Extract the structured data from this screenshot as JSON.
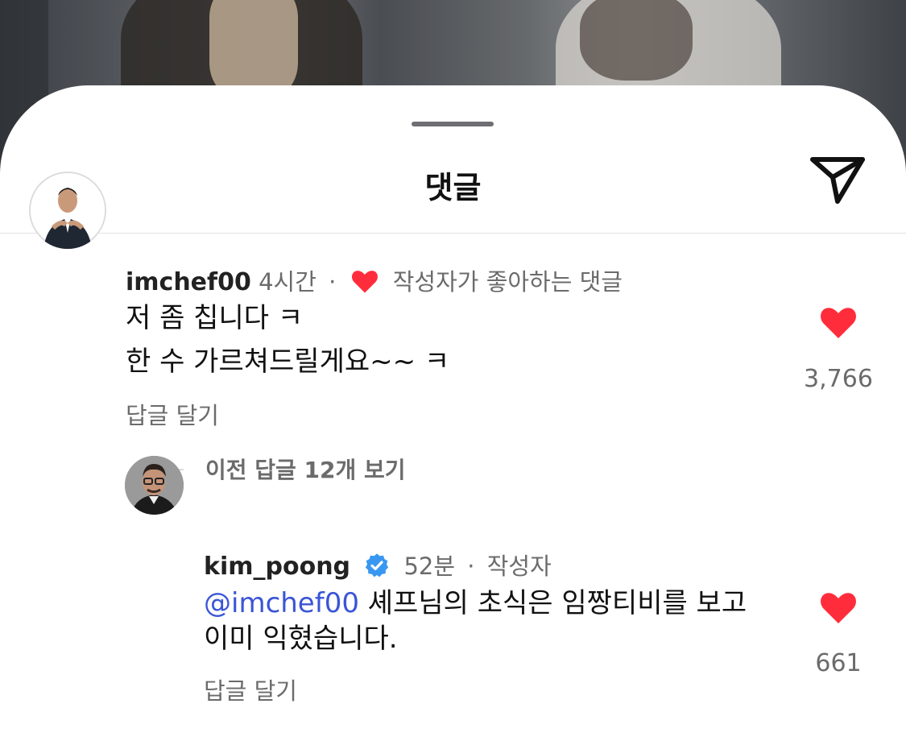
{
  "sheet": {
    "title": "댓글",
    "share_icon": "paper-plane-icon"
  },
  "comments": [
    {
      "username": "imchef00",
      "time": "4시간",
      "creator_liked_label": "작성자가 좋아하는 댓글",
      "lines": [
        "저 좀 칩니다 ㅋ",
        "한 수 가르쳐드릴게요~~ ㅋ"
      ],
      "like_count": "3,766",
      "liked": true,
      "reply_label": "답글 달기",
      "view_replies_label": "이전 답글 12개 보기"
    },
    {
      "username": "kim_poong",
      "verified": true,
      "time": "52분",
      "author_label": "작성자",
      "mention": "@imchef00",
      "lines": [
        " 셰프님의 초식은 임짱티비를 보고",
        "이미 익혔습니다."
      ],
      "like_count": "661",
      "liked": true,
      "reply_label": "답글 달기"
    }
  ],
  "colors": {
    "heart": "#ff2d3b",
    "mention": "#3a55d6",
    "verified": "#3897f0",
    "secondary_text": "#6b6b6b"
  }
}
